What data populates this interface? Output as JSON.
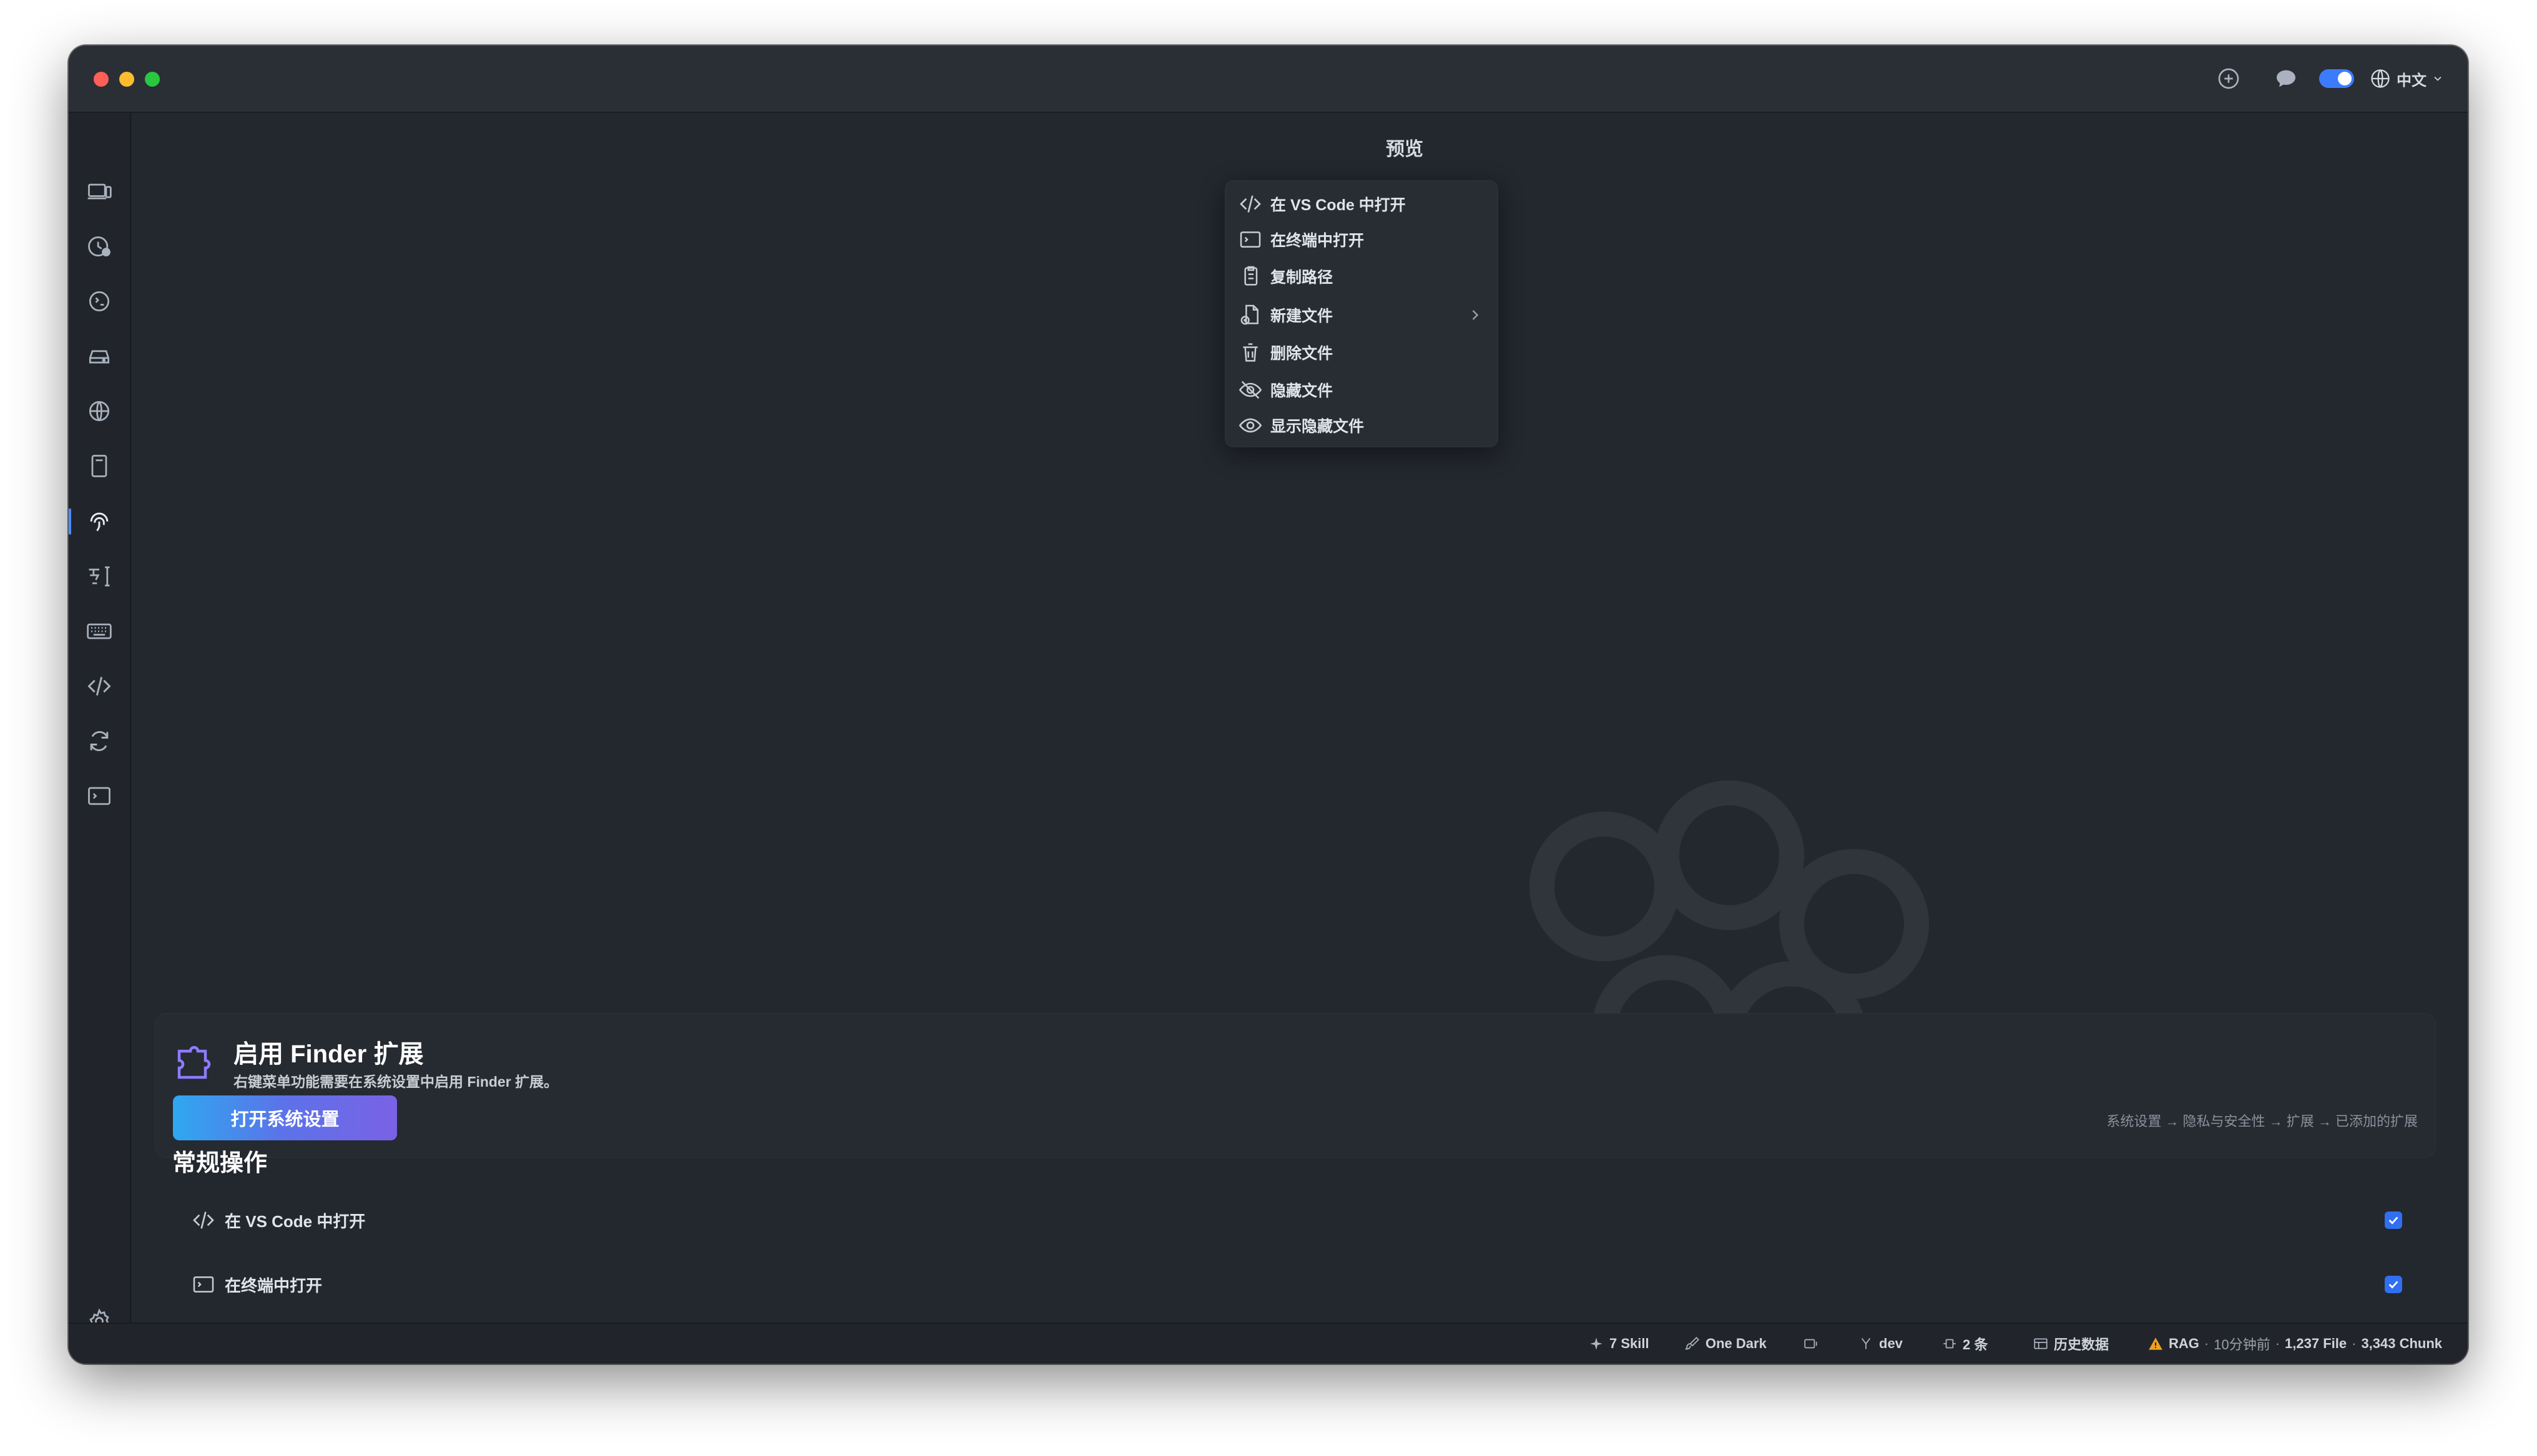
{
  "header": {
    "language_label": "中文",
    "toggle_on": true
  },
  "preview": {
    "title": "预览",
    "menu": [
      {
        "label": "在 VS Code 中打开",
        "icon": "code-icon"
      },
      {
        "label": "在终端中打开",
        "icon": "terminal-icon"
      },
      {
        "label": "复制路径",
        "icon": "copy-icon"
      },
      {
        "label": "新建文件",
        "icon": "new-file-icon",
        "has_submenu": true
      },
      {
        "label": "删除文件",
        "icon": "trash-icon"
      },
      {
        "label": "隐藏文件",
        "icon": "eye-off-icon"
      },
      {
        "label": "显示隐藏文件",
        "icon": "eye-icon"
      }
    ]
  },
  "finder": {
    "title": "启用 Finder 扩展",
    "description": "右键菜单功能需要在系统设置中启用 Finder 扩展。",
    "button_label": "打开系统设置",
    "path_hint": "系统设置 → 隐私与安全性 → 扩展 → 已添加的扩展"
  },
  "operations": {
    "title": "常规操作",
    "items": [
      {
        "label": "在 VS Code 中打开",
        "icon": "code-icon",
        "checked": true
      },
      {
        "label": "在终端中打开",
        "icon": "terminal-icon",
        "checked": true
      }
    ]
  },
  "statusbar": {
    "skills": "7 Skill",
    "theme": "One Dark",
    "branch": "dev",
    "count": "2 条",
    "history": "历史数据",
    "rag_label": "RAG",
    "rag_time": "10分钟前",
    "rag_files": "1,237 File",
    "rag_chunks": "3,343 Chunk"
  },
  "colors": {
    "accent": "#3d7bfd",
    "window_bg": "#23272e",
    "warning": "#f0a020"
  }
}
